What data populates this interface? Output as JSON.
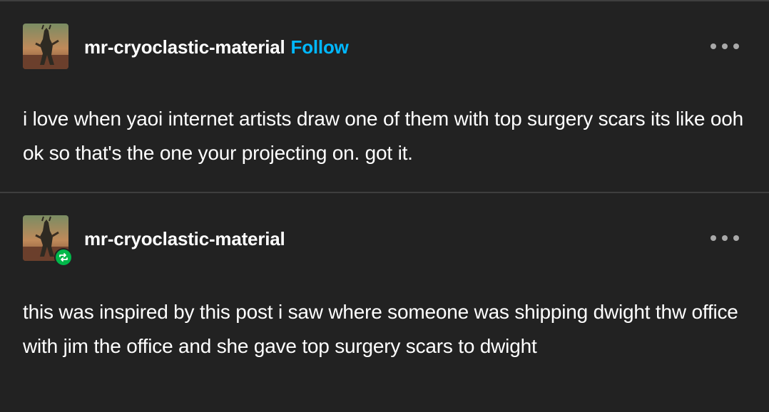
{
  "posts": [
    {
      "username": "mr-cryoclastic-material",
      "follow_label": "Follow",
      "body": "i love when yaoi internet artists draw one of them with top surgery scars its like ooh ok so that's the one your projecting on. got it.",
      "is_reblog": false
    },
    {
      "username": "mr-cryoclastic-material",
      "body": "this was inspired by this post i saw where someone was shipping dwight thw office with jim the office and she gave top surgery scars to dwight",
      "is_reblog": true
    }
  ],
  "icons": {
    "more": "ellipsis-icon",
    "reblog": "reblog-icon",
    "avatar": "avatar-image"
  },
  "colors": {
    "background": "#222222",
    "divider": "#3e3e3e",
    "follow_accent": "#00b8ff",
    "reblog_badge": "#00b84a",
    "text": "#ffffff",
    "more_dots": "#a9a9a9"
  }
}
